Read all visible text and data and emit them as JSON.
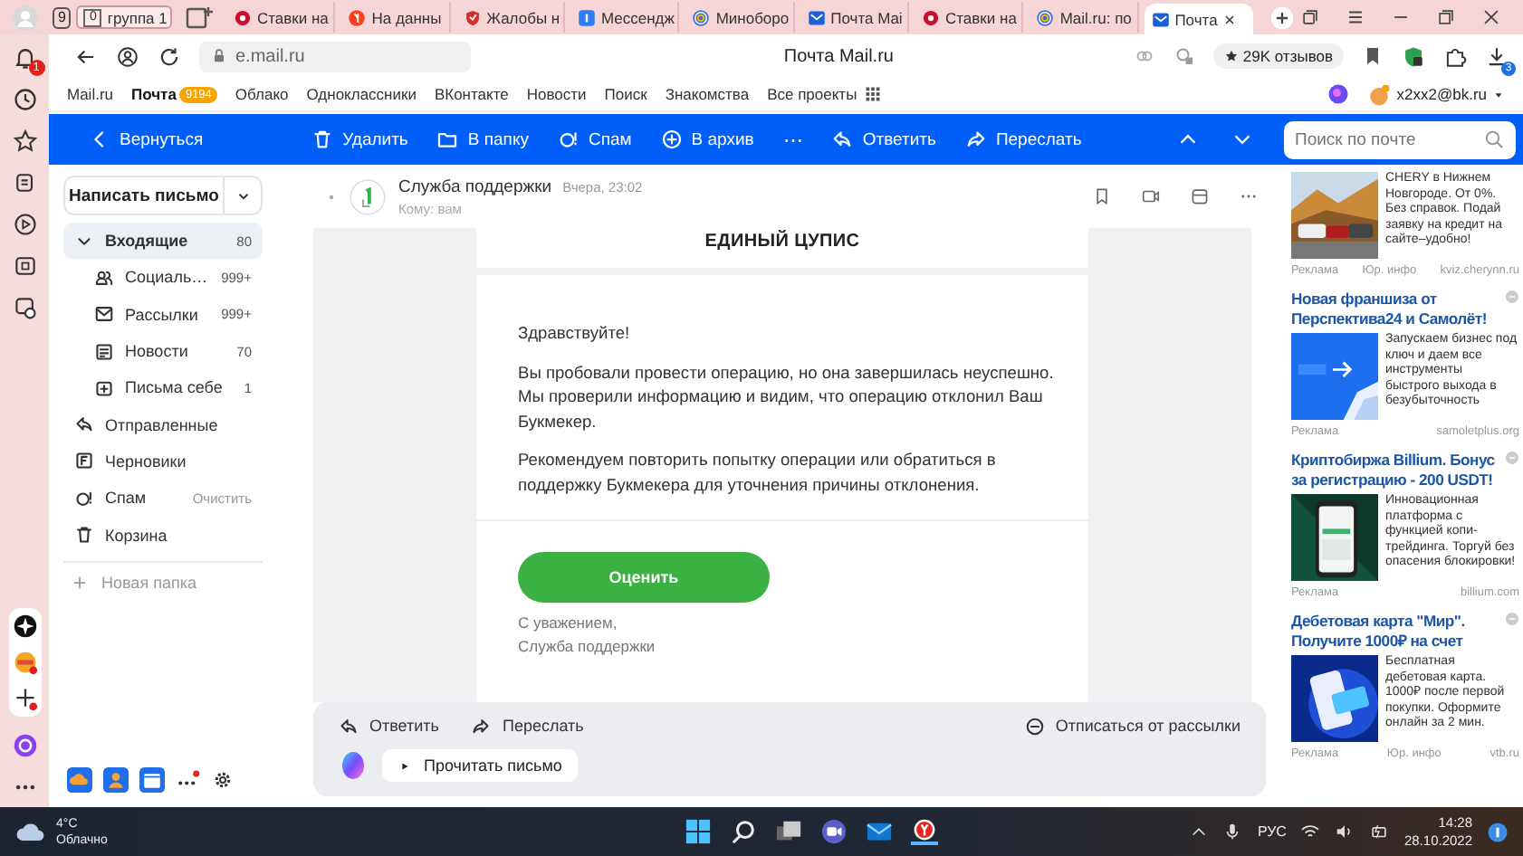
{
  "browser": {
    "tab_count": "9",
    "tabs": [
      {
        "label": "группа 1",
        "kind": "group",
        "count": "0",
        "selected": false
      },
      {
        "label": "Ставки на",
        "kind": "ball",
        "selected": false
      },
      {
        "label": "На данны",
        "kind": "yandex",
        "selected": false
      },
      {
        "label": "Жалобы н",
        "kind": "complaint",
        "selected": false
      },
      {
        "label": "Мессендж",
        "kind": "messenger",
        "selected": false
      },
      {
        "label": "Миноборо",
        "kind": "at",
        "selected": false
      },
      {
        "label": "Почта Mai",
        "kind": "mail",
        "selected": false
      },
      {
        "label": "Ставки на",
        "kind": "ball",
        "selected": false
      },
      {
        "label": "Mail.ru: по",
        "kind": "at",
        "selected": false
      },
      {
        "label": "Почта",
        "kind": "mail",
        "selected": true
      }
    ],
    "address": "e.mail.ru",
    "page_title": "Почта Mail.ru",
    "reviews": "29K отзывов",
    "notifications": "1",
    "downloads": "3"
  },
  "portal": {
    "items": [
      {
        "label": "Mail.ru",
        "selected": false
      },
      {
        "label": "Почта",
        "selected": true,
        "badge": "9194"
      },
      {
        "label": "Облако",
        "selected": false
      },
      {
        "label": "Одноклассники",
        "selected": false
      },
      {
        "label": "ВКонтакте",
        "selected": false
      },
      {
        "label": "Новости",
        "selected": false
      },
      {
        "label": "Поиск",
        "selected": false
      },
      {
        "label": "Знакомства",
        "selected": false
      },
      {
        "label": "Все проекты",
        "selected": false
      }
    ],
    "user": "x2xx2@bk.ru"
  },
  "toolbar": {
    "actions": [
      {
        "kind": "back",
        "label": "Вернуться"
      },
      {
        "kind": "delete",
        "label": "Удалить"
      },
      {
        "kind": "folder",
        "label": "В папку"
      },
      {
        "kind": "spam",
        "label": "Спам"
      },
      {
        "kind": "archive",
        "label": "В архив"
      },
      {
        "kind": "more",
        "label": "⋯"
      },
      {
        "kind": "reply",
        "label": "Ответить"
      },
      {
        "kind": "forward",
        "label": "Переслать"
      }
    ],
    "search": {
      "placeholder": "Поиск по почте"
    }
  },
  "sidebar": {
    "compose": "Написать письмо",
    "folders": [
      {
        "kind": "inbox",
        "label": "Входящие",
        "count": "80",
        "selected": true,
        "expanded": true,
        "children": [
          {
            "kind": "social",
            "label": "Социаль…",
            "count": "999+",
            "selected": false
          },
          {
            "kind": "newsletters",
            "label": "Рассылки",
            "count": "999+",
            "selected": false
          },
          {
            "kind": "news",
            "label": "Новости",
            "count": "70",
            "selected": false
          },
          {
            "kind": "self",
            "label": "Письма себе",
            "count": "1",
            "selected": false
          }
        ]
      },
      {
        "kind": "sent",
        "label": "Отправленные",
        "selected": false
      },
      {
        "kind": "drafts",
        "label": "Черновики",
        "selected": false
      },
      {
        "kind": "spam",
        "label": "Спам",
        "action": "Очистить",
        "selected": false
      },
      {
        "kind": "trash",
        "label": "Корзина",
        "selected": false
      }
    ],
    "new_folder": "Новая папка"
  },
  "message": {
    "sender": "Служба поддержки",
    "date": "Вчера, 23:02",
    "to": "Кому: вам",
    "body": {
      "brand": "ЕДИНЫЙ ЦУПИС",
      "greeting": "Здравствуйте!",
      "paragraphs": [
        "Вы пробовали провести операцию, но она завершилась неуспешно. Мы проверили информацию и видим, что операцию отклонил Ваш Букмекер.",
        "Рекомендуем повторить попытку операции или обратиться в поддержку Букмекера для уточнения причины отклонения."
      ],
      "button": "Оценить",
      "signature": [
        "С уважением,",
        "Служба поддержки"
      ]
    },
    "actions": [
      {
        "kind": "reply",
        "label": "Ответить"
      },
      {
        "kind": "forward",
        "label": "Переслать"
      },
      {
        "kind": "unsubscribe",
        "label": "Отписаться от рассылки"
      }
    ],
    "read_aloud": "Прочитать письмо"
  },
  "ads": [
    {
      "text": "CHERY в Нижнем Новгороде. От 0%. Без справок. Подай заявку на кредит на сайте–удобно!",
      "footer": [
        "Реклама",
        "Юр. инфо",
        "kviz.cherynn.ru"
      ]
    },
    {
      "title": "Новая франшиза от Перспектива24 и Самолёт!",
      "text": "Запускаем бизнес под ключ и даем все инструменты быстрого выхода в безубыточность",
      "footer": [
        "Реклама",
        "samoletplus.org"
      ]
    },
    {
      "title": "Криптобиржа Billium. Бонус за регистрацию - 200 USDT!",
      "text": "Инновационная платформа с функцией копи-трейдинга. Торгуй без опасения блокировки!",
      "footer": [
        "Реклама",
        "billium.com"
      ]
    },
    {
      "title": "Дебетовая карта \"Мир\". Получите 1000₽ на счет",
      "text": "Бесплатная дебетовая карта. 1000₽ после первой покупки. Оформите онлайн за 2 мин.",
      "footer": [
        "Реклама",
        "Юр. инфо",
        "vtb.ru"
      ]
    }
  ],
  "taskbar": {
    "temperature": "4°C",
    "weather": "Облачно",
    "language": "РУС",
    "time": "14:28",
    "date": "28.10.2022"
  }
}
